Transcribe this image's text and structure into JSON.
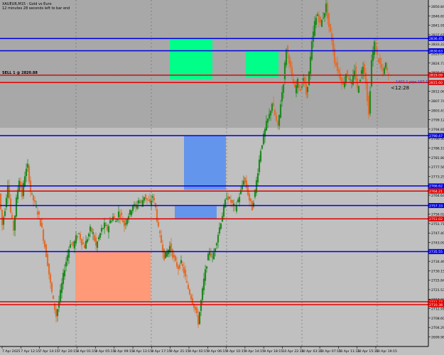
{
  "header": {
    "symbol_line": "XAUEUR,M15 : Gold vs Euro",
    "timer_line": "12 minutes 28 seconds left to bar end"
  },
  "order_label": "SELL 1 @ 2820.88",
  "trade_label": "1402.1 pips 167.1 12.28",
  "countdown": "<12:28",
  "colors": {
    "background": "#c0c0c0",
    "upper_zone": "#a8a8a8",
    "bull_candle": "#208a20",
    "bear_candle": "#e07030",
    "support_line": "#0000e0",
    "resistance_line": "#e00000",
    "green_box": "#00ff88",
    "blue_box": "#6495ed",
    "salmon_box": "#ff9977"
  },
  "price_axis": {
    "ticks": [
      "2850.84",
      "2846.69",
      "2841.91",
      "2837.61",
      "2833.22",
      "2829.04",
      "2824.73",
      "2820.67",
      "2816.37",
      "2812.06",
      "2807.74",
      "2803.43",
      "2799.12",
      "2794.81",
      "2790.50",
      "2786.19",
      "2781.88",
      "2777.56",
      "2773.25",
      "2768.94",
      "2764.64",
      "2760.33",
      "2756.02",
      "2751.71",
      "2747.40",
      "2743.09",
      "2738.77",
      "2734.46",
      "2730.15",
      "2725.84",
      "2721.53",
      "2717.22",
      "2712.91",
      "2708.60",
      "2704.29",
      "2699.98"
    ],
    "line_labels": [
      {
        "text": "2836.45",
        "kind": "support"
      },
      {
        "text": "2830.63",
        "kind": "support"
      },
      {
        "text": "2819.09",
        "kind": "resistance"
      },
      {
        "text": "2815.60",
        "kind": "resistance"
      },
      {
        "text": "2790.47",
        "kind": "support"
      },
      {
        "text": "2766.62",
        "kind": "support"
      },
      {
        "text": "2764.21",
        "kind": "resistance"
      },
      {
        "text": "2757.33",
        "kind": "support"
      },
      {
        "text": "2751.02",
        "kind": "resistance"
      },
      {
        "text": "2735.55",
        "kind": "support"
      },
      {
        "text": "2711.77",
        "kind": "resistance"
      },
      {
        "text": "2710.38",
        "kind": "resistance"
      }
    ]
  },
  "time_axis": {
    "ticks": [
      "7 Apr 2025",
      "7 Apr 12:15",
      "7 Apr 14:15",
      "7 Apr 20:15",
      "8 Apr 01:15",
      "8 Apr 05:15",
      "8 Apr 09:15",
      "8 Apr 13:15",
      "8 Apr 17:15",
      "9 Apr 21:15",
      "9 Apr 02:15",
      "9 Apr 06:15",
      "9 Apr 10:15",
      "9 Apr 14:15",
      "9 Apr 18:15",
      "10 Apr 22:15",
      "10 Apr 03:15",
      "10 Apr 07:15",
      "10 Apr 11:15",
      "10 Apr 15:15",
      "10 Apr 19:15"
    ]
  },
  "chart_data": {
    "type": "candlestick",
    "symbol": "XAUEUR",
    "timeframe": "M15",
    "ylim": [
      2697,
      2854
    ],
    "grid": "vertical dotted separators",
    "horizontal_lines": [
      {
        "price": 2836.45,
        "kind": "support"
      },
      {
        "price": 2830.63,
        "kind": "support"
      },
      {
        "price": 2819.09,
        "kind": "resistance"
      },
      {
        "price": 2815.6,
        "kind": "resistance"
      },
      {
        "price": 2790.47,
        "kind": "support"
      },
      {
        "price": 2766.62,
        "kind": "support"
      },
      {
        "price": 2764.21,
        "kind": "resistance"
      },
      {
        "price": 2757.33,
        "kind": "support"
      },
      {
        "price": 2751.02,
        "kind": "resistance"
      },
      {
        "price": 2735.55,
        "kind": "support"
      },
      {
        "price": 2711.77,
        "kind": "resistance"
      },
      {
        "price": 2710.38,
        "kind": "resistance"
      }
    ],
    "zones": [
      {
        "kind": "green",
        "price_top": 2836.4,
        "price_bottom": 2817.1,
        "time_from": "9 Apr 21:15",
        "time_to": "9 Apr 02:15"
      },
      {
        "kind": "green",
        "price_top": 2830.8,
        "price_bottom": 2818.0,
        "time_from": "9 Apr 14:15",
        "time_to": "9 Apr 18:15"
      },
      {
        "kind": "blue",
        "price_top": 2790.2,
        "price_bottom": 2764.8,
        "time_from": "9 Apr 02:15",
        "time_to": "9 Apr 06:15"
      },
      {
        "kind": "blue",
        "price_top": 2757.0,
        "price_bottom": 2751.0,
        "time_from": "8 Apr 17:15",
        "time_to": "9 Apr 06:15"
      },
      {
        "kind": "salmon",
        "price_top": 2735.6,
        "price_bottom": 2712.2,
        "time_from": "7 Apr 20:15",
        "time_to": "8 Apr 13:15"
      }
    ],
    "close_path": [
      [
        0,
        2763
      ],
      [
        4,
        2748
      ],
      [
        8,
        2756
      ],
      [
        12,
        2768
      ],
      [
        16,
        2754
      ],
      [
        20,
        2746
      ],
      [
        24,
        2760
      ],
      [
        28,
        2770
      ],
      [
        32,
        2762
      ],
      [
        36,
        2772
      ],
      [
        40,
        2776
      ],
      [
        44,
        2764
      ],
      [
        48,
        2760
      ],
      [
        52,
        2756
      ],
      [
        56,
        2752
      ],
      [
        60,
        2746
      ],
      [
        64,
        2738
      ],
      [
        68,
        2730
      ],
      [
        72,
        2720
      ],
      [
        76,
        2712
      ],
      [
        80,
        2705
      ],
      [
        84,
        2712
      ],
      [
        88,
        2720
      ],
      [
        92,
        2728
      ],
      [
        96,
        2734
      ],
      [
        100,
        2740
      ],
      [
        104,
        2738
      ],
      [
        108,
        2742
      ],
      [
        112,
        2744
      ],
      [
        116,
        2740
      ],
      [
        120,
        2738
      ],
      [
        124,
        2742
      ],
      [
        128,
        2746
      ],
      [
        132,
        2744
      ],
      [
        136,
        2738
      ],
      [
        140,
        2742
      ],
      [
        144,
        2746
      ],
      [
        148,
        2748
      ],
      [
        152,
        2746
      ],
      [
        156,
        2750
      ],
      [
        160,
        2752
      ],
      [
        164,
        2750
      ],
      [
        168,
        2754
      ],
      [
        172,
        2752
      ],
      [
        176,
        2748
      ],
      [
        180,
        2752
      ],
      [
        184,
        2754
      ],
      [
        188,
        2758
      ],
      [
        192,
        2756
      ],
      [
        196,
        2760
      ],
      [
        200,
        2758
      ],
      [
        204,
        2762
      ],
      [
        208,
        2760
      ],
      [
        212,
        2758
      ],
      [
        216,
        2762
      ],
      [
        220,
        2756
      ],
      [
        224,
        2746
      ],
      [
        228,
        2740
      ],
      [
        232,
        2733
      ],
      [
        236,
        2735
      ],
      [
        240,
        2738
      ],
      [
        244,
        2734
      ],
      [
        248,
        2730
      ],
      [
        252,
        2728
      ],
      [
        256,
        2730
      ],
      [
        260,
        2726
      ],
      [
        264,
        2720
      ],
      [
        268,
        2716
      ],
      [
        272,
        2712
      ],
      [
        276,
        2708
      ],
      [
        280,
        2702
      ],
      [
        284,
        2712
      ],
      [
        288,
        2722
      ],
      [
        292,
        2730
      ],
      [
        296,
        2736
      ],
      [
        300,
        2732
      ],
      [
        304,
        2738
      ],
      [
        308,
        2744
      ],
      [
        312,
        2750
      ],
      [
        316,
        2756
      ],
      [
        320,
        2762
      ],
      [
        324,
        2760
      ],
      [
        328,
        2758
      ],
      [
        332,
        2756
      ],
      [
        336,
        2760
      ],
      [
        340,
        2764
      ],
      [
        344,
        2770
      ],
      [
        348,
        2766
      ],
      [
        352,
        2760
      ],
      [
        356,
        2756
      ],
      [
        360,
        2764
      ],
      [
        364,
        2774
      ],
      [
        368,
        2784
      ],
      [
        372,
        2790
      ],
      [
        376,
        2796
      ],
      [
        380,
        2800
      ],
      [
        384,
        2806
      ],
      [
        388,
        2800
      ],
      [
        392,
        2794
      ],
      [
        396,
        2806
      ],
      [
        400,
        2816
      ],
      [
        404,
        2832
      ],
      [
        408,
        2826
      ],
      [
        412,
        2818
      ],
      [
        416,
        2812
      ],
      [
        420,
        2816
      ],
      [
        424,
        2812
      ],
      [
        428,
        2818
      ],
      [
        432,
        2810
      ],
      [
        436,
        2820
      ],
      [
        440,
        2834
      ],
      [
        444,
        2844
      ],
      [
        448,
        2848
      ],
      [
        452,
        2843
      ],
      [
        456,
        2847
      ],
      [
        460,
        2852
      ],
      [
        464,
        2842
      ],
      [
        468,
        2836
      ],
      [
        472,
        2826
      ],
      [
        476,
        2822
      ],
      [
        480,
        2818
      ],
      [
        484,
        2814
      ],
      [
        488,
        2820
      ],
      [
        492,
        2818
      ],
      [
        496,
        2814
      ],
      [
        500,
        2822
      ],
      [
        504,
        2812
      ],
      [
        508,
        2818
      ],
      [
        512,
        2824
      ],
      [
        516,
        2816
      ],
      [
        520,
        2800
      ],
      [
        524,
        2826
      ],
      [
        528,
        2834
      ],
      [
        532,
        2828
      ],
      [
        536,
        2824
      ],
      [
        540,
        2820
      ],
      [
        544,
        2824
      ],
      [
        548,
        2818
      ]
    ]
  }
}
